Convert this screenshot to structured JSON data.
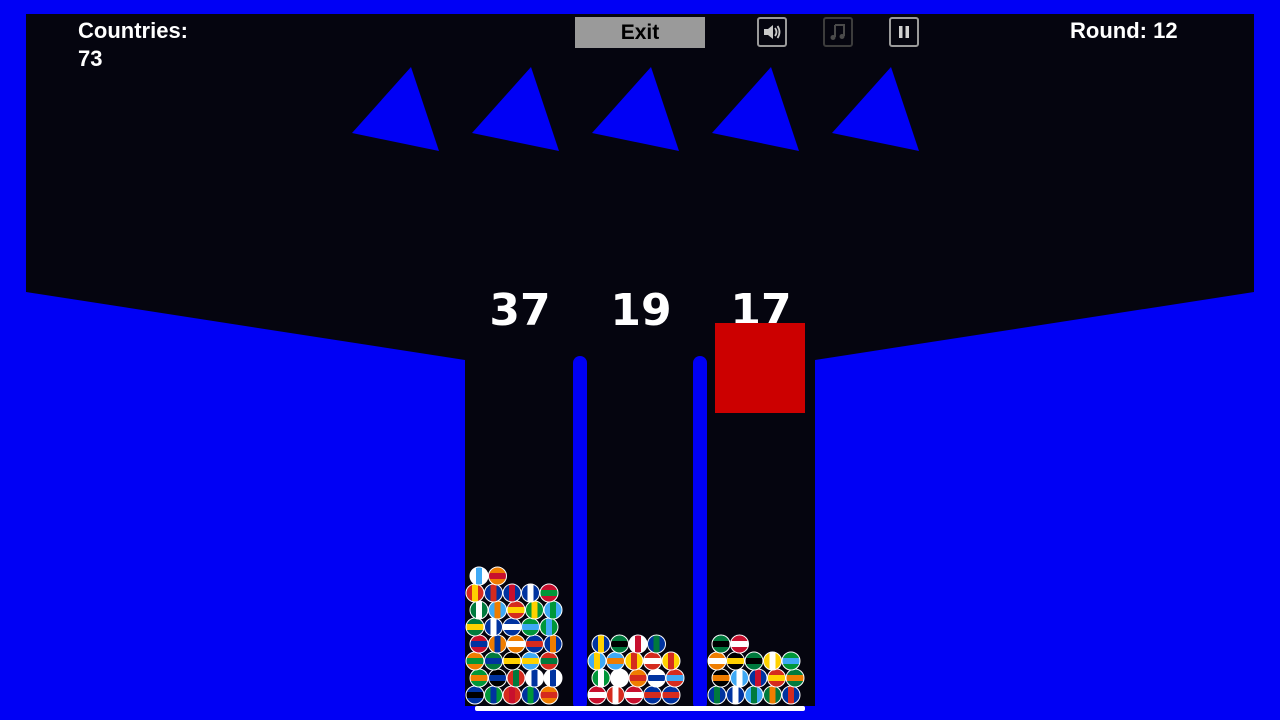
{
  "hud": {
    "countries_label": "Countries:",
    "countries_value": "73",
    "round_text": "Round: 12",
    "exit_label": "Exit"
  },
  "controls": {
    "sound_icon": "speaker-icon",
    "music_icon": "music-note-icon",
    "pause_icon": "pause-icon"
  },
  "scores": [
    "37",
    "19",
    "17"
  ],
  "colors": {
    "background": "#0000f5",
    "arena": "#05050f",
    "spinners": "#0000f5",
    "block": "#cc0000",
    "text": "#ffffff",
    "exit_button": "#9a9a9a"
  },
  "spinner_count": 5,
  "balls_per_column": [
    37,
    19,
    17
  ]
}
